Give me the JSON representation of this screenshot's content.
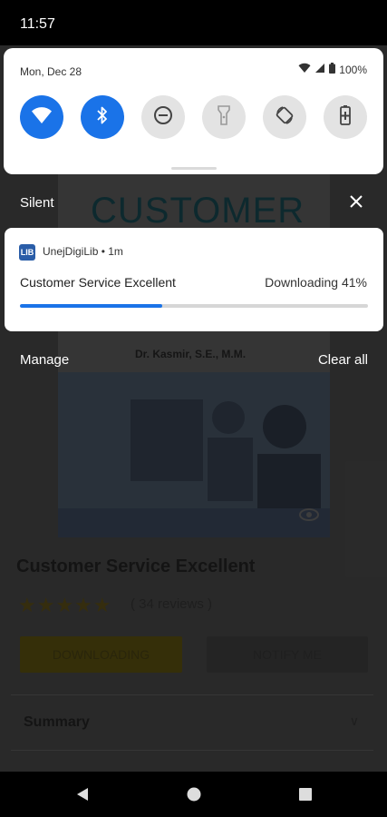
{
  "status_bar": {
    "time": "11:57"
  },
  "quick_settings": {
    "date": "Mon, Dec 28",
    "battery": "100%",
    "tiles": [
      {
        "name": "wifi",
        "state": "on"
      },
      {
        "name": "bluetooth",
        "state": "on"
      },
      {
        "name": "do-not-disturb",
        "state": "off"
      },
      {
        "name": "flashlight",
        "state": "off"
      },
      {
        "name": "auto-rotate",
        "state": "off"
      },
      {
        "name": "battery-saver",
        "state": "off"
      }
    ]
  },
  "silent_section": {
    "label": "Silent",
    "close_icon": "close-icon"
  },
  "notification": {
    "app_icon_text": "LIB",
    "app_meta": "UnejDigiLib • 1m",
    "title": "Customer Service Excellent",
    "status": "Downloading 41%",
    "progress": 0.41,
    "accent": "#1a73e8"
  },
  "footer_actions": {
    "manage": "Manage",
    "clear_all": "Clear all"
  },
  "background_app": {
    "cover_title": "CUSTOMER",
    "cover_author": "Dr. Kasmir, S.E., M.M.",
    "book_title": "Customer Service Excellent",
    "rating_stars": "★★★★★",
    "reviews": "( 34 reviews )",
    "download_button": "DOWNLOADING",
    "other_button": "NOTIFY ME",
    "summary_label": "Summary",
    "summary_chevron": "∨"
  }
}
